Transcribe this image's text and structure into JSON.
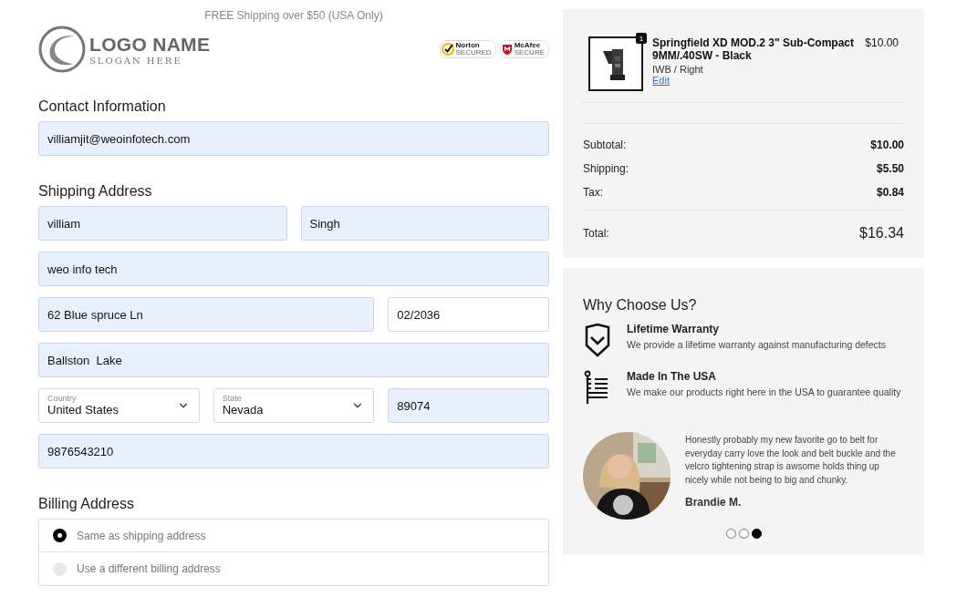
{
  "banner": "FREE Shipping over $50 (USA Only)",
  "logo": {
    "name": "LOGO NAME",
    "slogan": "SLOGAN HERE"
  },
  "trust_badges": [
    {
      "kind": "norton",
      "title": "Norton",
      "subtitle": "SECURED"
    },
    {
      "kind": "mcafee",
      "title": "McAfee",
      "subtitle": "SECURE"
    }
  ],
  "contact": {
    "heading": "Contact Information",
    "fields": [
      {
        "kind": "input",
        "value": "villiamjit@weoinfotech.com",
        "autofilled": true
      }
    ]
  },
  "shipping": {
    "heading": "Shipping Address",
    "fields": [
      {
        "kind": "input",
        "value": "villiam",
        "autofilled": true
      },
      {
        "kind": "input",
        "value": "Singh",
        "autofilled": true
      },
      {
        "kind": "input",
        "value": "weo info tech",
        "autofilled": true
      },
      {
        "kind": "input",
        "value": "62 Blue spruce Ln",
        "autofilled": true
      },
      {
        "kind": "input",
        "value": "02/2036",
        "autofilled": false
      },
      {
        "kind": "input",
        "value": "Ballston  Lake",
        "autofilled": true
      },
      {
        "kind": "select",
        "label": "Country",
        "value": "United States",
        "autofilled": false
      },
      {
        "kind": "select",
        "label": "State",
        "value": "Nevada",
        "autofilled": false
      },
      {
        "kind": "input",
        "value": "89074",
        "autofilled": true
      },
      {
        "kind": "input",
        "value": "9876543210",
        "autofilled": true
      }
    ]
  },
  "billing": {
    "heading": "Billing Address",
    "options": [
      {
        "label": "Same as shipping address",
        "selected": true
      },
      {
        "label": "Use a different billing address",
        "selected": false
      }
    ]
  },
  "order": {
    "items": [
      {
        "quantity": "1",
        "name": "Springfield XD MOD.2 3\" Sub-Compact 9MM/.40SW - Black",
        "variant": "IWB / Right",
        "edit": "Edit",
        "price": "$10.00"
      }
    ],
    "lines": [
      {
        "label": "Subtotal:",
        "value": "$10.00"
      },
      {
        "label": "Shipping:",
        "value": "$5.50"
      },
      {
        "label": "Tax:",
        "value": "$0.84"
      }
    ],
    "total": {
      "label": "Total:",
      "value": "$16.34"
    }
  },
  "why": {
    "heading": "Why Choose Us?",
    "features": [
      {
        "kind": "shield",
        "title": "Lifetime Warranty",
        "text": "We provide a lifetime warranty against manufacturing defects"
      },
      {
        "kind": "flag",
        "title": "Made In The USA",
        "text": "We make our products right here in the USA to guarantee quality"
      }
    ],
    "testimonial": {
      "quote": "Honestly probably my new favorite go to belt for everyday carry love the look and belt buckle and the velcro tightening strap is awsome holds thing up nicely while not being to big and chunky.",
      "author": "Brandie M."
    },
    "dots": [
      {
        "selected": false
      },
      {
        "selected": false
      },
      {
        "selected": true
      }
    ]
  }
}
